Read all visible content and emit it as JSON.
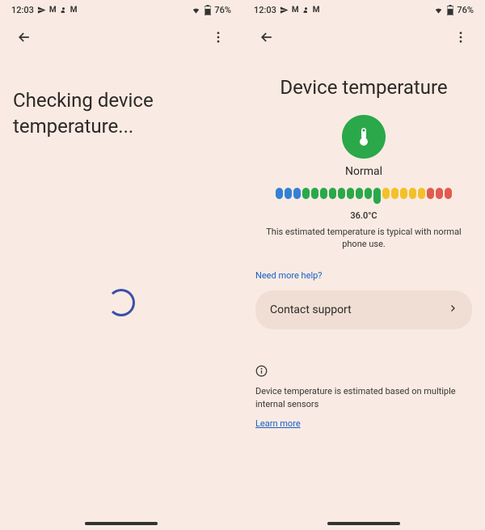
{
  "status": {
    "time": "12:03",
    "battery": "76%"
  },
  "screenA": {
    "title": "Checking device temperature..."
  },
  "screenB": {
    "title": "Device temperature",
    "statusLabel": "Normal",
    "tempValue": "36.0°C",
    "tempDesc": "This estimated temperature is typical with normal phone use.",
    "helpLink": "Need more help?",
    "supportLabel": "Contact support",
    "infoText": "Device temperature is estimated based on multiple internal sensors",
    "learnLink": "Learn more"
  },
  "chart_data": {
    "type": "bar",
    "title": "Device temperature gauge",
    "categories": [
      "blue",
      "blue",
      "blue",
      "green",
      "green",
      "green",
      "green",
      "green",
      "green",
      "green",
      "green",
      "green",
      "yellow",
      "yellow",
      "yellow",
      "yellow",
      "yellow",
      "red",
      "red",
      "red"
    ],
    "values": [
      1,
      1,
      1,
      1,
      1,
      1,
      1,
      1,
      1,
      1,
      1,
      1,
      1,
      1,
      1,
      1,
      1,
      1,
      1,
      1
    ],
    "marker_index": 11,
    "marker_value": 36.0,
    "marker_label": "36.0°C"
  }
}
